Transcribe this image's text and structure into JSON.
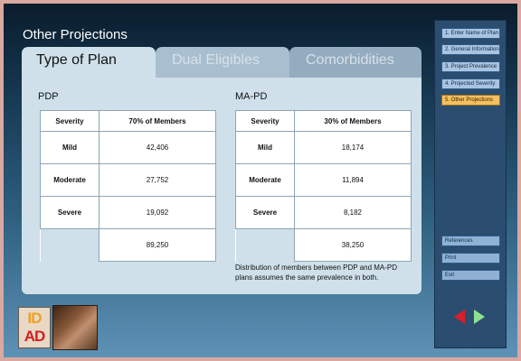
{
  "page": {
    "title": "Other Projections"
  },
  "tabs": [
    {
      "label": "Type of Plan",
      "active": true
    },
    {
      "label": "Dual Eligibles",
      "active": false
    },
    {
      "label": "Comorbidities",
      "active": false
    }
  ],
  "pdp": {
    "title": "PDP",
    "headers": [
      "Severity",
      "70% of Members"
    ],
    "rows": [
      {
        "severity": "Mild",
        "value": "42,406"
      },
      {
        "severity": "Moderate",
        "value": "27,752"
      },
      {
        "severity": "Severe",
        "value": "19,092"
      }
    ],
    "total": "89,250"
  },
  "mapd": {
    "title": "MA-PD",
    "headers": [
      "Severity",
      "30% of Members"
    ],
    "rows": [
      {
        "severity": "Mild",
        "value": "18,174"
      },
      {
        "severity": "Moderate",
        "value": "11,894"
      },
      {
        "severity": "Severe",
        "value": "8,182"
      }
    ],
    "total": "38,250"
  },
  "note": "Distribution of members between PDP and MA-PD plans assumes the same prevalence in both.",
  "sidebar": {
    "nav": [
      {
        "label": "1. Enter Name of Plan",
        "active": false
      },
      {
        "label": "2. General Information",
        "active": false
      },
      {
        "label": "3. Project Prevalence",
        "active": false
      },
      {
        "label": "4. Projected Severity",
        "active": false
      },
      {
        "label": "5. Other Projections",
        "active": true
      }
    ],
    "utility": [
      {
        "label": "References"
      },
      {
        "label": "Print"
      },
      {
        "label": "Exit"
      }
    ]
  },
  "logo": {
    "line1": "ID",
    "line2": "AD"
  },
  "colors": {
    "active_nav": "#f4c060",
    "prev_arrow": "#d8202a",
    "next_arrow": "#8fe090"
  },
  "icons": {
    "prev": "arrow-left-icon",
    "next": "arrow-right-icon"
  }
}
